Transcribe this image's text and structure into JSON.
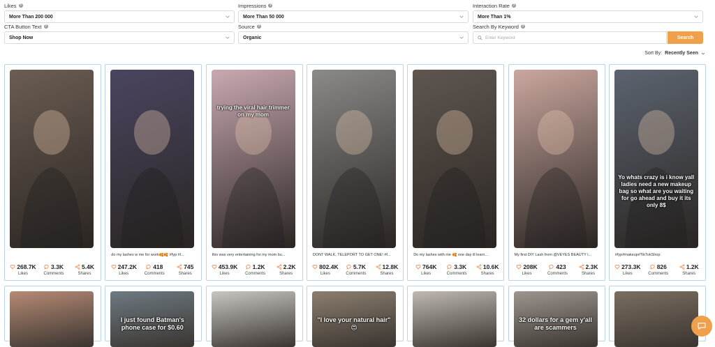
{
  "filters": {
    "likes_label": "Likes",
    "likes_value": "More Than 200 000",
    "impressions_label": "Impressions",
    "impressions_value": "More Than 50 000",
    "interaction_label": "Interaction Rate",
    "interaction_value": "More Than 1%",
    "cta_label": "CTA Button Text",
    "cta_value": "Shop Now",
    "source_label": "Source",
    "source_value": "Organic",
    "keyword_label": "Search By Keyword",
    "keyword_placeholder": "Enter Keyword",
    "search_button": "Search"
  },
  "sort": {
    "label": "Sort By:",
    "value": "Recently Seen"
  },
  "stat_labels": {
    "likes": "Likes",
    "comments": "Comments",
    "shares": "Shares"
  },
  "cards": [
    {
      "caption": "",
      "overlay": "",
      "likes": "268.7K",
      "comments": "3.3K",
      "shares": "5.4K",
      "bg": "#6b5d52"
    },
    {
      "caption": "do my lashes w me for work🥰🥰 #fyp #l...",
      "overlay": "",
      "likes": "247.2K",
      "comments": "418",
      "shares": "745",
      "bg": "#4a4560"
    },
    {
      "caption": "this was very entertaining for my mom bu...",
      "overlay": "trying the viral hair trimmer on my mom",
      "likes": "453.9K",
      "comments": "1.2K",
      "shares": "2.2K",
      "bg": "#c9a9b1"
    },
    {
      "caption": "DONT WALK, TELEPORT TO GET ONE! #f...",
      "overlay": "",
      "likes": "802.4K",
      "comments": "5.7K",
      "shares": "12.8K",
      "bg": "#8a8a88"
    },
    {
      "caption": "Do my lashes with me 🥰 one day ill learn...",
      "overlay": "",
      "likes": "764K",
      "comments": "3.3K",
      "shares": "10.6K",
      "bg": "#5f5650"
    },
    {
      "caption": "My first DIY Lash from @VEYES BEAUTY l...",
      "overlay": "",
      "likes": "208K",
      "comments": "423",
      "shares": "2.3K",
      "bg": "#caa79f"
    },
    {
      "caption": "#fyp#makeup#TikTokShop",
      "overlay": "Yo whats crazy is i know yall ladies need a new makeup bag so what are you waiting for go ahead and buy it its only 8$",
      "likes": "273.3K",
      "comments": "826",
      "shares": "1.2K",
      "bg": "#5c6470"
    }
  ],
  "row2": [
    {
      "overlay": "",
      "bg": "#b68a75"
    },
    {
      "overlay": "I just found Batman's phone case for $0.60",
      "bg": "#6e7a82"
    },
    {
      "overlay": "",
      "bg": "#c9c6c1"
    },
    {
      "overlay": "\"I love your natural hair\" 😍",
      "bg": "#8b7e6e"
    },
    {
      "overlay": "",
      "bg": "#bfb9b2"
    },
    {
      "overlay": "32 dollars for a gem y'all are scammers",
      "bg": "#9d958e"
    },
    {
      "overlay": "",
      "bg": "#7a6e60"
    }
  ],
  "colors": {
    "accent": "#f0a04b",
    "card_border": "#b9d3ee",
    "stat_icon": "#e8894a"
  }
}
